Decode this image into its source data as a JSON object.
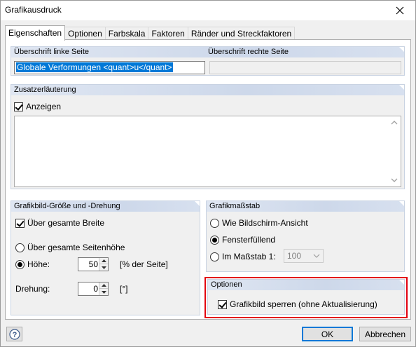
{
  "window": {
    "title": "Grafikausdruck",
    "close_icon": "close-icon"
  },
  "tabs": [
    {
      "label": "Eigenschaften",
      "active": true
    },
    {
      "label": "Optionen",
      "active": false
    },
    {
      "label": "Farbskala",
      "active": false
    },
    {
      "label": "Faktoren",
      "active": false
    },
    {
      "label": "Ränder und Streckfaktoren",
      "active": false
    }
  ],
  "headings": {
    "left_page": {
      "title": "Überschrift linke Seite",
      "value": "Globale Verformungen <quant>u</quant>"
    },
    "right_page": {
      "title": "Überschrift rechte Seite",
      "value": ""
    }
  },
  "additional_note": {
    "title": "Zusatzerläuterung",
    "show_label": "Anzeigen",
    "show_checked": true,
    "text": ""
  },
  "size_rotation": {
    "title": "Grafikbild-Größe und -Drehung",
    "full_width_label": "Über gesamte Breite",
    "full_width_checked": true,
    "full_height_label": "Über gesamte Seitenhöhe",
    "height_label": "Höhe:",
    "height_value": "50",
    "height_unit": "[% der Seite]",
    "rotation_label": "Drehung:",
    "rotation_value": "0",
    "rotation_unit": "[°]"
  },
  "scale": {
    "title": "Grafikmaßstab",
    "options": [
      {
        "label": "Wie Bildschirm-Ansicht",
        "selected": false
      },
      {
        "label": "Fensterfüllend",
        "selected": true
      },
      {
        "label": "Im Maßstab 1:",
        "selected": false
      }
    ],
    "scale_value": "100"
  },
  "options": {
    "title": "Optionen",
    "lock_label": "Grafikbild sperren (ohne Aktualisierung)",
    "lock_checked": true
  },
  "footer": {
    "help_icon": "help-icon",
    "ok_label": "OK",
    "cancel_label": "Abbrechen"
  },
  "colors": {
    "group_header": "#cdd8ea",
    "highlight": "#e3000f",
    "selection": "#0078d7"
  }
}
